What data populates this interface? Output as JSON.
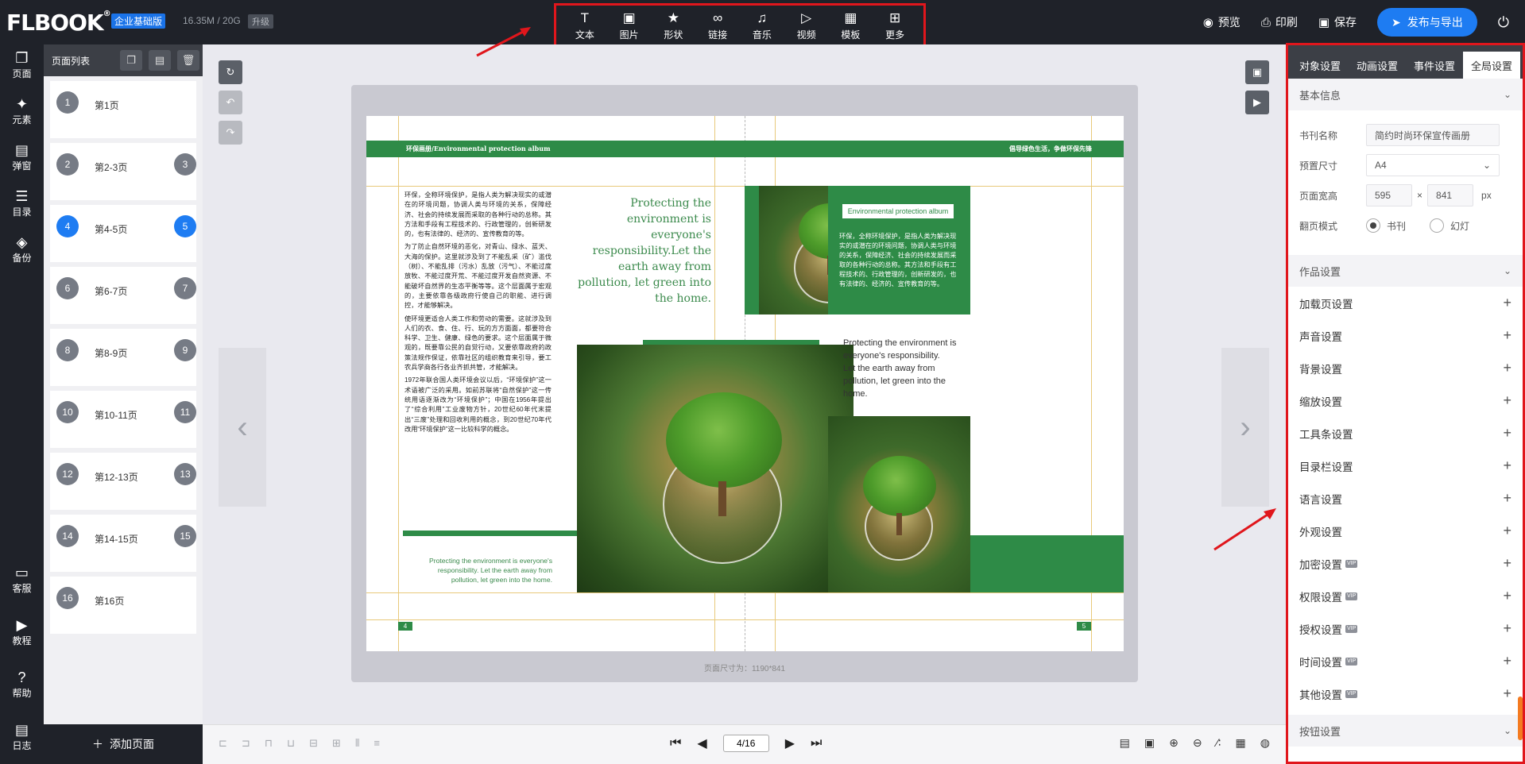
{
  "header": {
    "logo": "FLBOOK",
    "edition": "企业基础版",
    "storage": "16.35M / 20G",
    "upgrade": "升级",
    "tools": [
      {
        "label": "文本",
        "icon": "text-icon",
        "glyph": "T"
      },
      {
        "label": "图片",
        "icon": "image-icon",
        "glyph": "▣"
      },
      {
        "label": "形状",
        "icon": "star-icon",
        "glyph": "★"
      },
      {
        "label": "链接",
        "icon": "link-icon",
        "glyph": "∞"
      },
      {
        "label": "音乐",
        "icon": "music-icon",
        "glyph": "♫"
      },
      {
        "label": "视频",
        "icon": "video-icon",
        "glyph": "▷"
      },
      {
        "label": "模板",
        "icon": "template-icon",
        "glyph": "▦"
      },
      {
        "label": "更多",
        "icon": "more-icon",
        "glyph": "⊞"
      }
    ],
    "preview": "预览",
    "print": "印刷",
    "save": "保存",
    "publish": "发布与导出"
  },
  "leftnav": [
    {
      "label": "页面",
      "icon": "page-icon",
      "glyph": "❐"
    },
    {
      "label": "元素",
      "icon": "elements-icon",
      "glyph": "✦"
    },
    {
      "label": "弹窗",
      "icon": "popup-icon",
      "glyph": "▤"
    },
    {
      "label": "目录",
      "icon": "catalog-icon",
      "glyph": "☰"
    },
    {
      "label": "备份",
      "icon": "backup-icon",
      "glyph": "◈"
    },
    {
      "label": "客服",
      "icon": "service-icon",
      "glyph": "▭"
    },
    {
      "label": "教程",
      "icon": "tutorial-icon",
      "glyph": "▶"
    },
    {
      "label": "帮助",
      "icon": "help-icon",
      "glyph": "?"
    },
    {
      "label": "日志",
      "icon": "log-icon",
      "glyph": "▤"
    }
  ],
  "pagelist": {
    "title": "页面列表",
    "add_page": "添加页面",
    "items": [
      {
        "label": "第1页",
        "left": "1",
        "right": ""
      },
      {
        "label": "第2-3页",
        "left": "2",
        "right": "3"
      },
      {
        "label": "第4-5页",
        "left": "4",
        "right": "5"
      },
      {
        "label": "第6-7页",
        "left": "6",
        "right": "7"
      },
      {
        "label": "第8-9页",
        "left": "8",
        "right": "9"
      },
      {
        "label": "第10-11页",
        "left": "10",
        "right": "11"
      },
      {
        "label": "第12-13页",
        "left": "12",
        "right": "13"
      },
      {
        "label": "第14-15页",
        "left": "14",
        "right": "15"
      },
      {
        "label": "第16页",
        "left": "16",
        "right": ""
      }
    ]
  },
  "spread": {
    "header_left": "环保画册/Environmental protection album",
    "header_right": "倡导绿色生活，争做环保先锋",
    "para1": "环保，全称环境保护，是指人类为解决现实的或潜在的环境问题，协调人类与环境的关系，保障经济、社会的持续发展而采取的各种行动的总称。其方法和手段有工程技术的、行政管理的，创新研发的，也有法律的、经济的、宣传教育的等。",
    "para2": "为了防止自然环境的恶化，对青山、绿水、蓝天、大海的保护。这里就涉及到了不能乱采（矿）滥伐（树）、不能乱排（污水）乱放（污气）、不能过度放牧、不能过度开荒、不能过度开发自然资源、不能破坏自然界的生态平衡等等。这个层面属于宏观的，主要依靠各级政府行使自己的职能、进行调控，才能够解决。",
    "para3": "使环境更适合人类工作和劳动的需要。这就涉及到人们的衣、食、住、行、玩的方方面面，都要符合科学、卫生、健康、绿色的要求。这个层面属于微观的，既要靠公民的自觉行动，又要依靠政府的政策法规作保证，依靠社区的组织教育来引导，要工农兵学商各行各业齐抓共管，才能解决。",
    "para4": "1972年联合国人类环境会议以后，“环境保护”这一术语被广泛的采用。如前苏联将“自然保护”这一传统用语逐渐改为“环境保护”；中国在1956年提出了“综合利用”工业废物方针，20世纪60年代末提出“三废”处理和回收利用的概念，到20世纪70年代改用“环境保护”这一比较科学的概念。",
    "quote_big": "Protecting the environment is everyone's responsibility.Let the earth away from pollution, let green into the home.",
    "quote_small": "Protecting the environment is everyone's responsibility. Let the earth away from pollution, let green into the home.",
    "green_title": "Environmental protection album",
    "green_text": "环保，全称环境保护，是指人类为解决现实的或潜在的环境问题，协调人类与环境的关系，保障经济、社会的持续发展而采取的各种行动的总称。其方法和手段有工程技术的、行政管理的，创新研发的，也有法律的、经济的、宣传教育的等。",
    "quote_right": "Protecting the environment is everyone's responsibility.\nLet the earth away from pollution, let green into the home.",
    "page_left": "4",
    "page_right": "5",
    "size_note": "页面尺寸为：1190*841"
  },
  "bottom": {
    "page_value": "4/16"
  },
  "rpanel": {
    "tabs": [
      "对象设置",
      "动画设置",
      "事件设置",
      "全局设置"
    ],
    "basic_info": "基本信息",
    "book_name_label": "书刊名称",
    "book_name": "简约时尚环保宣传画册",
    "preset_label": "预置尺寸",
    "preset": "A4",
    "size_label": "页面宽高",
    "width": "595",
    "height": "841",
    "times": "×",
    "unit": "px",
    "flip_label": "翻页模式",
    "flip_book": "书刊",
    "flip_slide": "幻灯",
    "work_settings": "作品设置",
    "settings": [
      {
        "label": "加载页设置",
        "vip": ""
      },
      {
        "label": "声音设置",
        "vip": ""
      },
      {
        "label": "背景设置",
        "vip": ""
      },
      {
        "label": "缩放设置",
        "vip": ""
      },
      {
        "label": "工具条设置",
        "vip": ""
      },
      {
        "label": "目录栏设置",
        "vip": ""
      },
      {
        "label": "语言设置",
        "vip": ""
      },
      {
        "label": "外观设置",
        "vip": ""
      },
      {
        "label": "加密设置",
        "vip": "VIP"
      },
      {
        "label": "权限设置",
        "vip": "VIP"
      },
      {
        "label": "授权设置",
        "vip": "VIP"
      },
      {
        "label": "时间设置",
        "vip": "VIP"
      },
      {
        "label": "其他设置",
        "vip": "VIP"
      }
    ],
    "button_settings": "按钮设置"
  },
  "colors": {
    "accent": "#1e7cf2",
    "brand_green": "#2e8b47",
    "annotation_red": "#e0161c",
    "dark": "#1f2229"
  }
}
